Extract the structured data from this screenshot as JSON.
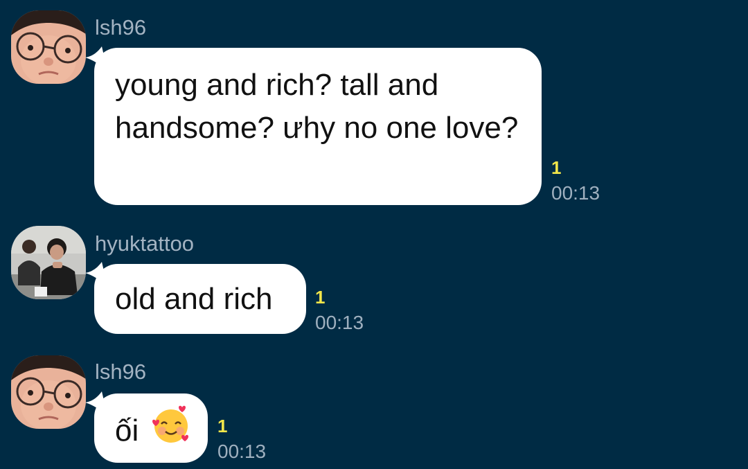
{
  "messages": [
    {
      "sender": "lsh96",
      "text": "young and rich? tall and handsome? ưhy no one love?",
      "unread": "1",
      "time": "00:13",
      "avatar_icon": "face-glasses-avatar-icon"
    },
    {
      "sender": "hyuktattoo",
      "text": "old and rich",
      "unread": "1",
      "time": "00:13",
      "avatar_icon": "two-people-photo-avatar-icon"
    },
    {
      "sender": "lsh96",
      "text": "ối",
      "emoji": "smiling-face-with-hearts-icon",
      "unread": "1",
      "time": "00:13",
      "avatar_icon": "face-glasses-avatar-icon"
    }
  ],
  "colors": {
    "background": "#002B44",
    "bubble": "#FFFFFF",
    "unread": "#F2E64A",
    "meta_text": "#9FB0BF",
    "sender_text": "#A3B3C2"
  }
}
